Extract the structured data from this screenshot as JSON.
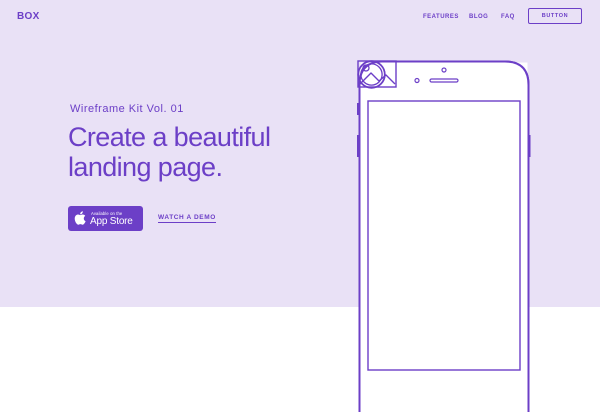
{
  "header": {
    "logo": "BOX",
    "nav": {
      "features": "FEATURES",
      "blog": "BLOG",
      "faq": "FAQ"
    },
    "button_label": "BUTTON"
  },
  "hero": {
    "eyebrow": "Wireframe Kit Vol. 01",
    "headline_line1": "Create a beautiful",
    "headline_line2": "landing page.",
    "app_store": {
      "small_text": "Available on the",
      "big_text": "App Store",
      "icon": "apple-icon"
    },
    "watch_demo": "WATCH A DEMO"
  },
  "phone": {
    "screen_icon": "image-placeholder-icon"
  },
  "colors": {
    "accent": "#6c3fc7",
    "hero_background": "#e9e1f6",
    "page_background": "#ffffff"
  }
}
